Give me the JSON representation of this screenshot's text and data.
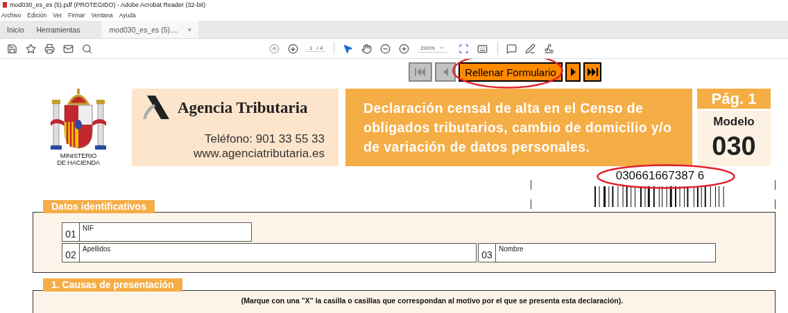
{
  "window": {
    "title": "mod030_es_es (5).pdf (PROTEGIDO) - Adobe Acrobat Reader (32-bit)"
  },
  "menu": [
    "Archivo",
    "Edición",
    "Ver",
    "Firmar",
    "Ventana",
    "Ayuda"
  ],
  "tabs": [
    {
      "label": "Inicio",
      "selected": false
    },
    {
      "label": "Herramientas",
      "selected": false
    },
    {
      "label": "mod030_es_es (5)....",
      "selected": true,
      "close": "×"
    }
  ],
  "toolbar": {
    "page_current": "1",
    "page_total": "/ 4",
    "zoom": "200%"
  },
  "nav_buttons": [
    {
      "kind": "first",
      "disabled": true,
      "circled": false
    },
    {
      "kind": "prev",
      "disabled": true,
      "circled": false
    },
    {
      "kind": "fill",
      "label": "Rellenar Formulario",
      "disabled": false,
      "circled": true
    },
    {
      "kind": "next",
      "disabled": false,
      "circled": false
    },
    {
      "kind": "last",
      "disabled": false,
      "circled": false
    }
  ],
  "header": {
    "ministry": [
      "MINISTERIO",
      "DE HACIENDA"
    ],
    "agency": "Agencia Tributaria",
    "phone": "Teléfono: 901 33 55 33",
    "web": "www.agenciatributaria.es",
    "title": "Declaración censal de alta en el Censo de obligados tributarios, cambio de domicilio y/o de variación de datos personales.",
    "page": "Pág. 1",
    "model_label": "Modelo",
    "model_number": "030",
    "barcode_number": "030661667387 6",
    "barcode_circled": true
  },
  "sections": [
    {
      "title": "Datos identificativos",
      "rows": [
        [
          {
            "number": "01",
            "label": "NIF",
            "kind": "short"
          }
        ],
        [
          {
            "number": "02",
            "label": "Apellidos",
            "kind": "wide"
          },
          {
            "number": "03",
            "label": "Nombre",
            "kind": "medium"
          }
        ]
      ]
    },
    {
      "title": "1. Causas de presentación",
      "instruction": "(Marque con una \"X\" la casilla o casillas que correspondan al motivo por el que se presenta esta declaración)."
    }
  ]
}
